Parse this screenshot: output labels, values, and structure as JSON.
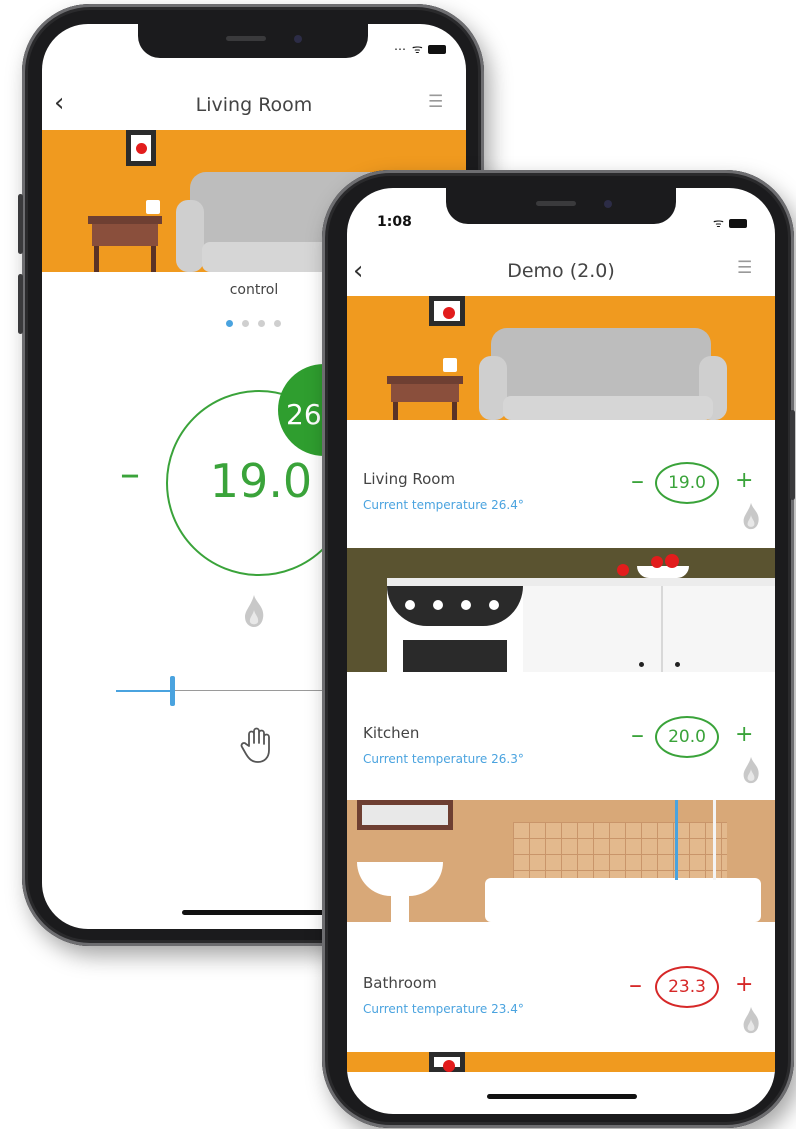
{
  "left_phone": {
    "nav": {
      "back_icon": "chevron-left-icon",
      "title": "Living Room",
      "menu_icon": "hamburger-icon"
    },
    "section_label": "control",
    "page_dots": {
      "count": 4,
      "active": 1
    },
    "target": {
      "value": "19.0",
      "minus": "–",
      "color": "#3aa33a"
    },
    "current_badge": {
      "value": "26.",
      "color": "#2f9e2f"
    },
    "slider": {
      "color": "#4aa3df"
    },
    "icons": {
      "flame": "flame-icon",
      "hand": "hand-icon"
    }
  },
  "right_phone": {
    "status": {
      "time": "1:08",
      "icons": "wifi-icon battery-icon"
    },
    "nav": {
      "back_icon": "chevron-left-icon",
      "title": "Demo (2.0)",
      "menu_icon": "hamburger-icon"
    },
    "rooms": [
      {
        "name": "Living Room",
        "current": "Current temperature 26.4°",
        "target": "19.0",
        "minus": "–",
        "plus": "+",
        "color": "#3aa33a"
      },
      {
        "name": "Kitchen",
        "current": "Current temperature 26.3°",
        "target": "20.0",
        "minus": "–",
        "plus": "+",
        "color": "#3aa33a"
      },
      {
        "name": "Bathroom",
        "current": "Current temperature 23.4°",
        "target": "23.3",
        "minus": "–",
        "plus": "+",
        "color": "#d62828"
      }
    ]
  },
  "colors": {
    "accent_green": "#3aa33a",
    "accent_red": "#d62828",
    "accent_blue": "#4aa3df",
    "wall_orange": "#f09a1f"
  }
}
